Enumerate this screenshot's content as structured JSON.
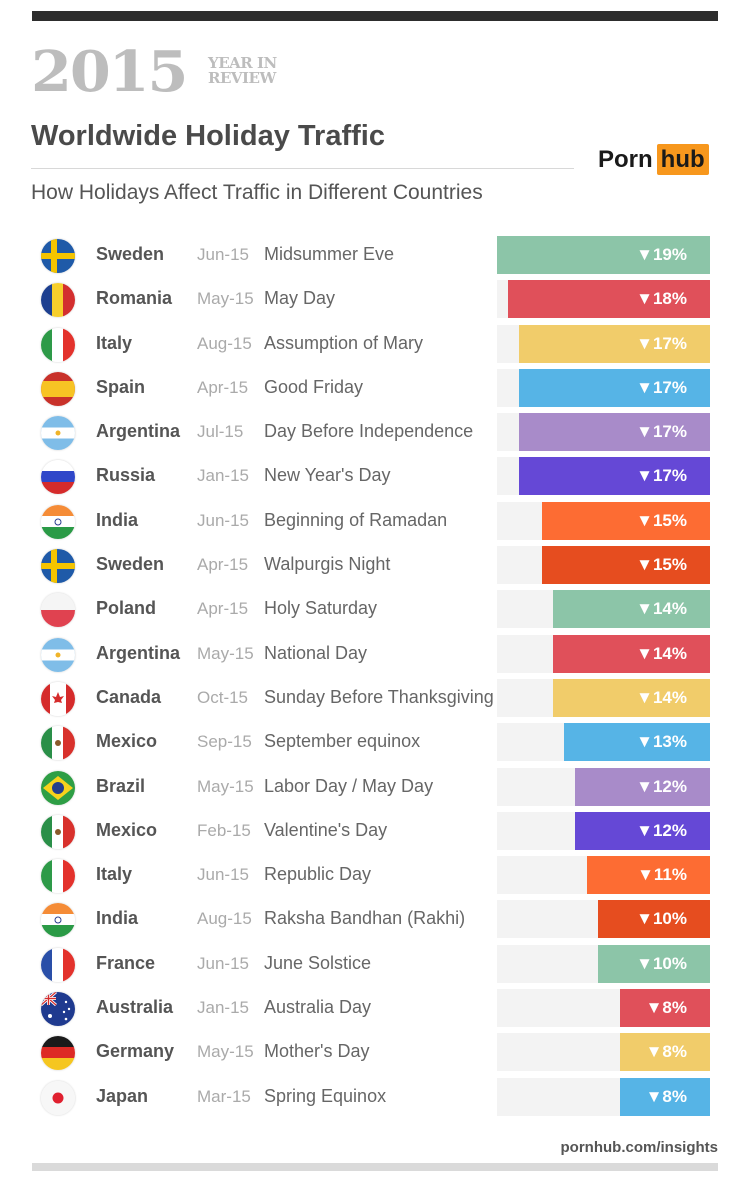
{
  "header": {
    "year": "2015",
    "year_in_review_line1": "YEAR IN",
    "year_in_review_line2": "REVIEW",
    "title": "Worldwide Holiday Traffic",
    "subtitle": "How Holidays Affect Traffic in Different Countries",
    "logo_left": "Porn",
    "logo_right": "hub"
  },
  "footer": {
    "url": "pornhub.com/insights"
  },
  "colors": {
    "accent": "#f7971d",
    "track": "#f3f3f3"
  },
  "chart_data": {
    "type": "bar",
    "orientation": "horizontal",
    "title": "Worldwide Holiday Traffic",
    "subtitle": "How Holidays Affect Traffic in Different Countries",
    "xlabel": "",
    "ylabel": "",
    "value_unit": "% traffic decrease",
    "xlim": [
      0,
      19
    ],
    "grid": false,
    "legend": "none",
    "rows": [
      {
        "country": "Sweden",
        "flag": "sweden-flag-icon",
        "date": "Jun-15",
        "holiday": "Midsummer Eve",
        "value": 19,
        "label": "▼19%",
        "color": "#8cc5a8"
      },
      {
        "country": "Romania",
        "flag": "romania-flag-icon",
        "date": "May-15",
        "holiday": "May Day",
        "value": 18,
        "label": "▼18%",
        "color": "#e0505a"
      },
      {
        "country": "Italy",
        "flag": "italy-flag-icon",
        "date": "Aug-15",
        "holiday": "Assumption of Mary",
        "value": 17,
        "label": "▼17%",
        "color": "#f1cc6a"
      },
      {
        "country": "Spain",
        "flag": "spain-flag-icon",
        "date": "Apr-15",
        "holiday": "Good Friday",
        "value": 17,
        "label": "▼17%",
        "color": "#56b4e6"
      },
      {
        "country": "Argentina",
        "flag": "argentina-flag-icon",
        "date": "Jul-15",
        "holiday": "Day Before Independence",
        "value": 17,
        "label": "▼17%",
        "color": "#a88bc9"
      },
      {
        "country": "Russia",
        "flag": "russia-flag-icon",
        "date": "Jan-15",
        "holiday": "New Year's Day",
        "value": 17,
        "label": "▼17%",
        "color": "#6548d6"
      },
      {
        "country": "India",
        "flag": "india-flag-icon",
        "date": "Jun-15",
        "holiday": "Beginning of Ramadan",
        "value": 15,
        "label": "▼15%",
        "color": "#fd6c33"
      },
      {
        "country": "Sweden",
        "flag": "sweden-flag-icon",
        "date": "Apr-15",
        "holiday": "Walpurgis Night",
        "value": 15,
        "label": "▼15%",
        "color": "#e64d1f"
      },
      {
        "country": "Poland",
        "flag": "poland-flag-icon",
        "date": "Apr-15",
        "holiday": "Holy Saturday",
        "value": 14,
        "label": "▼14%",
        "color": "#8cc5a8"
      },
      {
        "country": "Argentina",
        "flag": "argentina-flag-icon",
        "date": "May-15",
        "holiday": "National Day",
        "value": 14,
        "label": "▼14%",
        "color": "#e0505a"
      },
      {
        "country": "Canada",
        "flag": "canada-flag-icon",
        "date": "Oct-15",
        "holiday": "Sunday Before Thanksgiving",
        "value": 14,
        "label": "▼14%",
        "color": "#f1cc6a"
      },
      {
        "country": "Mexico",
        "flag": "mexico-flag-icon",
        "date": "Sep-15",
        "holiday": "September equinox",
        "value": 13,
        "label": "▼13%",
        "color": "#56b4e6"
      },
      {
        "country": "Brazil",
        "flag": "brazil-flag-icon",
        "date": "May-15",
        "holiday": "Labor Day / May Day",
        "value": 12,
        "label": "▼12%",
        "color": "#a88bc9"
      },
      {
        "country": "Mexico",
        "flag": "mexico-flag-icon",
        "date": "Feb-15",
        "holiday": "Valentine's Day",
        "value": 12,
        "label": "▼12%",
        "color": "#6548d6"
      },
      {
        "country": "Italy",
        "flag": "italy-flag-icon",
        "date": "Jun-15",
        "holiday": "Republic Day",
        "value": 11,
        "label": "▼11%",
        "color": "#fd6c33"
      },
      {
        "country": "India",
        "flag": "india-flag-icon",
        "date": "Aug-15",
        "holiday": "Raksha Bandhan (Rakhi)",
        "value": 10,
        "label": "▼10%",
        "color": "#e64d1f"
      },
      {
        "country": "France",
        "flag": "france-flag-icon",
        "date": "Jun-15",
        "holiday": "June Solstice",
        "value": 10,
        "label": "▼10%",
        "color": "#8cc5a8"
      },
      {
        "country": "Australia",
        "flag": "australia-flag-icon",
        "date": "Jan-15",
        "holiday": "Australia Day",
        "value": 8,
        "label": "▼8%",
        "color": "#e0505a"
      },
      {
        "country": "Germany",
        "flag": "germany-flag-icon",
        "date": "May-15",
        "holiday": "Mother's Day",
        "value": 8,
        "label": "▼8%",
        "color": "#f1cc6a"
      },
      {
        "country": "Japan",
        "flag": "japan-flag-icon",
        "date": "Mar-15",
        "holiday": "Spring Equinox",
        "value": 8,
        "label": "▼8%",
        "color": "#56b4e6"
      }
    ]
  }
}
